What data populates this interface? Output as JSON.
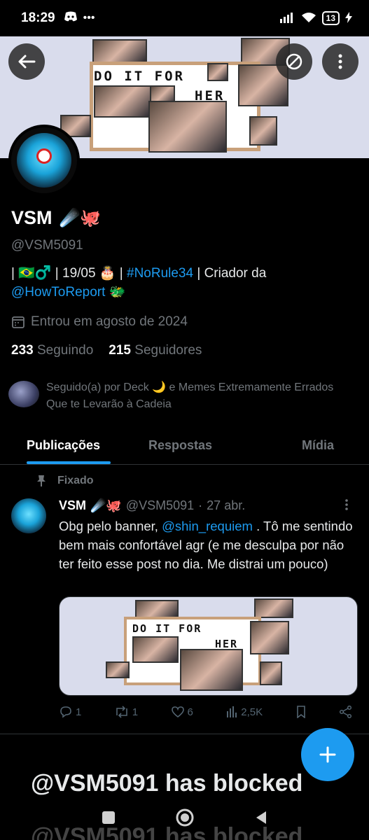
{
  "status_bar": {
    "time": "18:29",
    "battery": "13"
  },
  "profile": {
    "display_name": "VSM",
    "name_emoji": "☄️🐙",
    "handle": "@VSM5091",
    "bio_line1_prefix": "| 🇧🇷♂️ | 19/05 🎂 | ",
    "bio_hashtag": "#NoRule34",
    "bio_line1_suffix": " | Criador da",
    "bio_mention": "@HowToReport",
    "bio_mention_emoji": " 🐲",
    "joined": "Entrou em agosto de 2024",
    "following_count": "233",
    "following_label": "Seguindo",
    "followers_count": "215",
    "followers_label": "Seguidores",
    "followed_by": "Seguido(a) por Deck 🌙 e Memes Extremamente Errados Que te Levarão à Cadeia"
  },
  "banner": {
    "line1": "DO IT FOR",
    "line2": "HER"
  },
  "tabs": [
    {
      "label": "Publicações",
      "active": true
    },
    {
      "label": "Respostas",
      "active": false
    },
    {
      "label": "Mídia",
      "active": false
    }
  ],
  "tweet": {
    "pinned_label": "Fixado",
    "name": "VSM",
    "name_emoji": "☄️🐙",
    "handle": "@VSM5091",
    "dot": "·",
    "date": "27 abr.",
    "text_prefix": "Obg pelo banner, ",
    "mention": "@shin_requiem",
    "text_suffix": " . Tô me sentindo bem mais confortável agr (e me desculpa por não ter feito esse post no dia. Me distrai um pouco)",
    "replies": "1",
    "retweets": "1",
    "likes": "6",
    "views": "2,5K"
  },
  "overlay": {
    "blocked_text": "@VSM5091 has blocked"
  },
  "colors": {
    "accent": "#1d9bf0",
    "muted": "#71767b",
    "background": "#000000"
  }
}
